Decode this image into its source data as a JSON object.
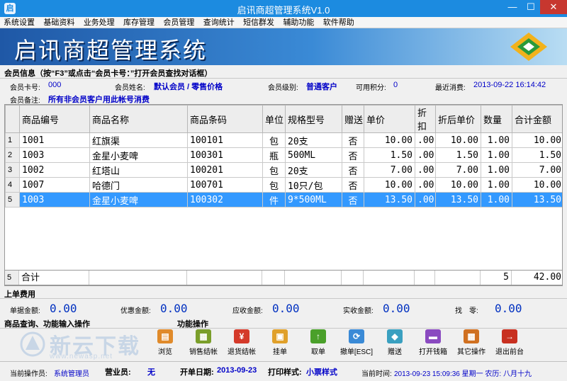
{
  "window": {
    "title": "启讯商超管理系统V1.0",
    "min": "—",
    "max": "☐",
    "close": "✕"
  },
  "menu": [
    "系统设置",
    "基础资料",
    "业务处理",
    "库存管理",
    "会员管理",
    "查询统计",
    "短信群发",
    "辅助功能",
    "软件帮助"
  ],
  "banner": {
    "title": "启讯商超管理系统"
  },
  "member": {
    "section": "会员信息（按“F3”或点击“会员卡号：”打开会员查找对话框）",
    "card_label": "会员卡号:",
    "card_value": "000",
    "name_label": "会员姓名:",
    "name_value": "默认会员 / 零售价格",
    "level_label": "会员级别:",
    "level_value": "普通客户",
    "points_label": "可用积分:",
    "points_value": "0",
    "last_label": "最近消费:",
    "last_value": "2013-09-22 16:14:42",
    "remark_label": "会员备注:",
    "remark_value": "所有非会员客户用此帐号消费"
  },
  "grid": {
    "headers": [
      "商品编号",
      "商品名称",
      "商品条码",
      "单位",
      "规格型号",
      "赠送",
      "单价",
      "折扣",
      "折后单价",
      "数量",
      "合计金额"
    ],
    "rows": [
      {
        "n": "1",
        "code": "1001",
        "name": "红旗渠",
        "barcode": "100101",
        "unit": "包",
        "spec": "20支",
        "gift": "否",
        "price": "10.00",
        "disc": ".00",
        "dprice": "10.00",
        "qty": "1.00",
        "total": "10.00"
      },
      {
        "n": "2",
        "code": "1003",
        "name": "金星小麦啤",
        "barcode": "100301",
        "unit": "瓶",
        "spec": "500ML",
        "gift": "否",
        "price": "1.50",
        "disc": ".00",
        "dprice": "1.50",
        "qty": "1.00",
        "total": "1.50"
      },
      {
        "n": "3",
        "code": "1002",
        "name": "红塔山",
        "barcode": "100201",
        "unit": "包",
        "spec": "20支",
        "gift": "否",
        "price": "7.00",
        "disc": ".00",
        "dprice": "7.00",
        "qty": "1.00",
        "total": "7.00"
      },
      {
        "n": "4",
        "code": "1007",
        "name": "哈德门",
        "barcode": "100701",
        "unit": "包",
        "spec": "10只/包",
        "gift": "否",
        "price": "10.00",
        "disc": ".00",
        "dprice": "10.00",
        "qty": "1.00",
        "total": "10.00"
      },
      {
        "n": "5",
        "code": "1003",
        "name": "金星小麦啤",
        "barcode": "100302",
        "unit": "件",
        "spec": "9*500ML",
        "gift": "否",
        "price": "13.50",
        "disc": ".00",
        "dprice": "13.50",
        "qty": "1.00",
        "total": "13.50"
      }
    ],
    "selected_row": 4
  },
  "totals": {
    "n": "5",
    "label": "合计",
    "qty": "5",
    "amount": "42.00"
  },
  "bill": {
    "section": "上单费用",
    "single_label": "单据金额:",
    "single_value": "0.00",
    "discount_label": "优惠金额:",
    "discount_value": "0.00",
    "receivable_label": "应收金额:",
    "receivable_value": "0.00",
    "received_label": "实收金额:",
    "received_value": "0.00",
    "change_label": "找　零:",
    "change_value": "0.00"
  },
  "query_section": "商品查询、功能输入操作",
  "ops_section": "功能操作",
  "toolbar": [
    {
      "label": "浏览",
      "icon": "browse-icon",
      "color": "#e08a2a"
    },
    {
      "label": "销售结帐",
      "icon": "sale-checkout-icon",
      "color": "#7a9e2a"
    },
    {
      "label": "退货结帐",
      "icon": "yen-icon",
      "color": "#d43a2a"
    },
    {
      "label": "挂单",
      "icon": "hold-order-icon",
      "color": "#e0a02a"
    },
    {
      "label": "取单",
      "icon": "up-arrow-icon",
      "color": "#4aa02a"
    },
    {
      "label": "撤单[ESC]",
      "icon": "refresh-icon",
      "color": "#3a8ad6"
    },
    {
      "label": "赠送",
      "icon": "gift-icon",
      "color": "#3aa0c0"
    },
    {
      "label": "打开钱箱",
      "icon": "cash-drawer-icon",
      "color": "#8a4ac0"
    },
    {
      "label": "其它操作",
      "icon": "other-ops-icon",
      "color": "#d07020"
    },
    {
      "label": "退出前台",
      "icon": "exit-icon",
      "color": "#c83020"
    }
  ],
  "watermark": {
    "text": "新云下载",
    "url": "www.newasp.net"
  },
  "status": {
    "operator_label": "当前操作员:",
    "operator_value": "系统管理员",
    "clerk_label": "营业员:",
    "clerk_value": "无",
    "open_label": "开单日期:",
    "open_value": "2013-09-23",
    "print_label": "打印样式:",
    "print_value": "小票样式",
    "time_label": "当前时间:",
    "time_value": "2013-09-23 15:09:36 星期一 农历: 八月十九"
  }
}
